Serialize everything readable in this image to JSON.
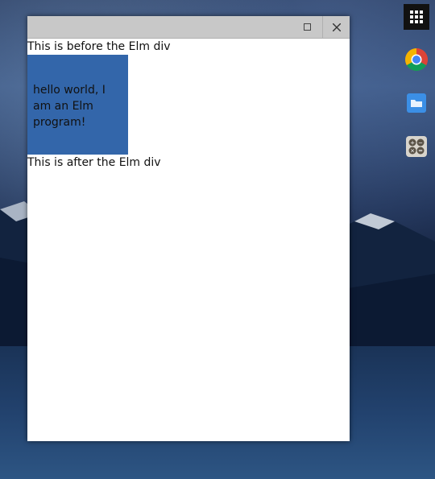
{
  "window": {
    "maximize_icon": "maximize-icon",
    "close_icon": "close-icon"
  },
  "content": {
    "before_text": "This is before the Elm div",
    "elm_text": "hello world, I\nam an Elm\nprogram!",
    "after_text": "This is after the Elm div",
    "elm_bg_color": "#3366aa"
  },
  "shelf": {
    "items": [
      "app-launcher-icon",
      "chrome-icon",
      "files-icon",
      "calculator-icon"
    ]
  }
}
